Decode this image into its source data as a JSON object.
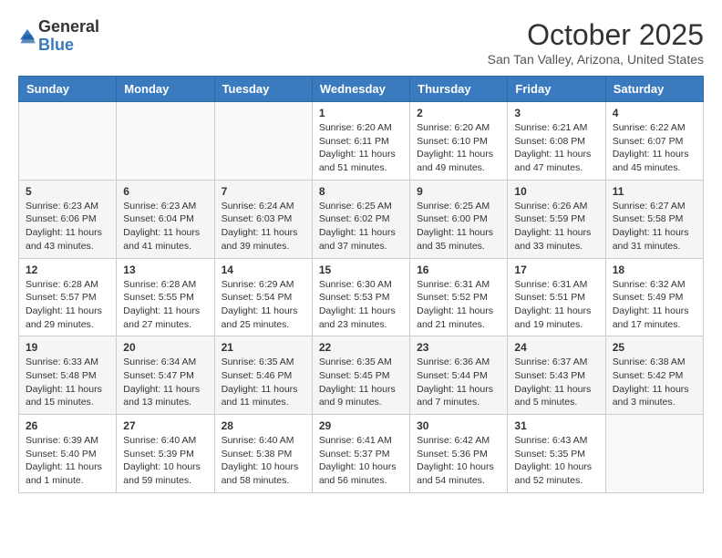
{
  "header": {
    "logo_general": "General",
    "logo_blue": "Blue",
    "month_title": "October 2025",
    "location": "San Tan Valley, Arizona, United States"
  },
  "days_of_week": [
    "Sunday",
    "Monday",
    "Tuesday",
    "Wednesday",
    "Thursday",
    "Friday",
    "Saturday"
  ],
  "weeks": [
    [
      {
        "day": "",
        "info": ""
      },
      {
        "day": "",
        "info": ""
      },
      {
        "day": "",
        "info": ""
      },
      {
        "day": "1",
        "info": "Sunrise: 6:20 AM\nSunset: 6:11 PM\nDaylight: 11 hours\nand 51 minutes."
      },
      {
        "day": "2",
        "info": "Sunrise: 6:20 AM\nSunset: 6:10 PM\nDaylight: 11 hours\nand 49 minutes."
      },
      {
        "day": "3",
        "info": "Sunrise: 6:21 AM\nSunset: 6:08 PM\nDaylight: 11 hours\nand 47 minutes."
      },
      {
        "day": "4",
        "info": "Sunrise: 6:22 AM\nSunset: 6:07 PM\nDaylight: 11 hours\nand 45 minutes."
      }
    ],
    [
      {
        "day": "5",
        "info": "Sunrise: 6:23 AM\nSunset: 6:06 PM\nDaylight: 11 hours\nand 43 minutes."
      },
      {
        "day": "6",
        "info": "Sunrise: 6:23 AM\nSunset: 6:04 PM\nDaylight: 11 hours\nand 41 minutes."
      },
      {
        "day": "7",
        "info": "Sunrise: 6:24 AM\nSunset: 6:03 PM\nDaylight: 11 hours\nand 39 minutes."
      },
      {
        "day": "8",
        "info": "Sunrise: 6:25 AM\nSunset: 6:02 PM\nDaylight: 11 hours\nand 37 minutes."
      },
      {
        "day": "9",
        "info": "Sunrise: 6:25 AM\nSunset: 6:00 PM\nDaylight: 11 hours\nand 35 minutes."
      },
      {
        "day": "10",
        "info": "Sunrise: 6:26 AM\nSunset: 5:59 PM\nDaylight: 11 hours\nand 33 minutes."
      },
      {
        "day": "11",
        "info": "Sunrise: 6:27 AM\nSunset: 5:58 PM\nDaylight: 11 hours\nand 31 minutes."
      }
    ],
    [
      {
        "day": "12",
        "info": "Sunrise: 6:28 AM\nSunset: 5:57 PM\nDaylight: 11 hours\nand 29 minutes."
      },
      {
        "day": "13",
        "info": "Sunrise: 6:28 AM\nSunset: 5:55 PM\nDaylight: 11 hours\nand 27 minutes."
      },
      {
        "day": "14",
        "info": "Sunrise: 6:29 AM\nSunset: 5:54 PM\nDaylight: 11 hours\nand 25 minutes."
      },
      {
        "day": "15",
        "info": "Sunrise: 6:30 AM\nSunset: 5:53 PM\nDaylight: 11 hours\nand 23 minutes."
      },
      {
        "day": "16",
        "info": "Sunrise: 6:31 AM\nSunset: 5:52 PM\nDaylight: 11 hours\nand 21 minutes."
      },
      {
        "day": "17",
        "info": "Sunrise: 6:31 AM\nSunset: 5:51 PM\nDaylight: 11 hours\nand 19 minutes."
      },
      {
        "day": "18",
        "info": "Sunrise: 6:32 AM\nSunset: 5:49 PM\nDaylight: 11 hours\nand 17 minutes."
      }
    ],
    [
      {
        "day": "19",
        "info": "Sunrise: 6:33 AM\nSunset: 5:48 PM\nDaylight: 11 hours\nand 15 minutes."
      },
      {
        "day": "20",
        "info": "Sunrise: 6:34 AM\nSunset: 5:47 PM\nDaylight: 11 hours\nand 13 minutes."
      },
      {
        "day": "21",
        "info": "Sunrise: 6:35 AM\nSunset: 5:46 PM\nDaylight: 11 hours\nand 11 minutes."
      },
      {
        "day": "22",
        "info": "Sunrise: 6:35 AM\nSunset: 5:45 PM\nDaylight: 11 hours\nand 9 minutes."
      },
      {
        "day": "23",
        "info": "Sunrise: 6:36 AM\nSunset: 5:44 PM\nDaylight: 11 hours\nand 7 minutes."
      },
      {
        "day": "24",
        "info": "Sunrise: 6:37 AM\nSunset: 5:43 PM\nDaylight: 11 hours\nand 5 minutes."
      },
      {
        "day": "25",
        "info": "Sunrise: 6:38 AM\nSunset: 5:42 PM\nDaylight: 11 hours\nand 3 minutes."
      }
    ],
    [
      {
        "day": "26",
        "info": "Sunrise: 6:39 AM\nSunset: 5:40 PM\nDaylight: 11 hours\nand 1 minute."
      },
      {
        "day": "27",
        "info": "Sunrise: 6:40 AM\nSunset: 5:39 PM\nDaylight: 10 hours\nand 59 minutes."
      },
      {
        "day": "28",
        "info": "Sunrise: 6:40 AM\nSunset: 5:38 PM\nDaylight: 10 hours\nand 58 minutes."
      },
      {
        "day": "29",
        "info": "Sunrise: 6:41 AM\nSunset: 5:37 PM\nDaylight: 10 hours\nand 56 minutes."
      },
      {
        "day": "30",
        "info": "Sunrise: 6:42 AM\nSunset: 5:36 PM\nDaylight: 10 hours\nand 54 minutes."
      },
      {
        "day": "31",
        "info": "Sunrise: 6:43 AM\nSunset: 5:35 PM\nDaylight: 10 hours\nand 52 minutes."
      },
      {
        "day": "",
        "info": ""
      }
    ]
  ]
}
